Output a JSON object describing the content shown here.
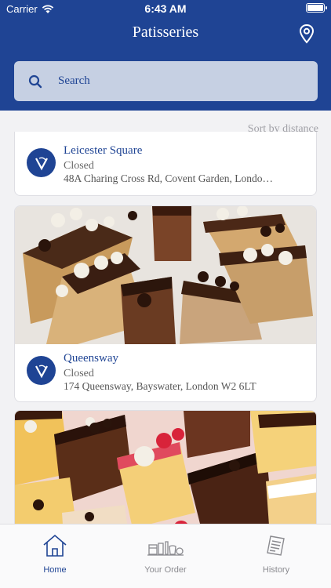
{
  "status_bar": {
    "carrier": "Carrier",
    "time": "6:43 AM"
  },
  "header": {
    "title": "Patisseries"
  },
  "search": {
    "placeholder": "Search"
  },
  "sort_label": "Sort by distance",
  "stores": [
    {
      "name": "Leicester Square",
      "status": "Closed",
      "address": "48A Charing Cross Rd, Covent Garden, Londo…"
    },
    {
      "name": "Queensway",
      "status": "Closed",
      "address": "174 Queensway, Bayswater, London W2 6LT"
    }
  ],
  "tabs": [
    {
      "label": "Home",
      "icon": "house-icon",
      "active": true
    },
    {
      "label": "Your Order",
      "icon": "order-icon",
      "active": false
    },
    {
      "label": "History",
      "icon": "receipt-icon",
      "active": false
    }
  ],
  "colors": {
    "brand": "#1f4494",
    "search_bg": "#c6d0e3",
    "background": "#f2f2f4"
  }
}
